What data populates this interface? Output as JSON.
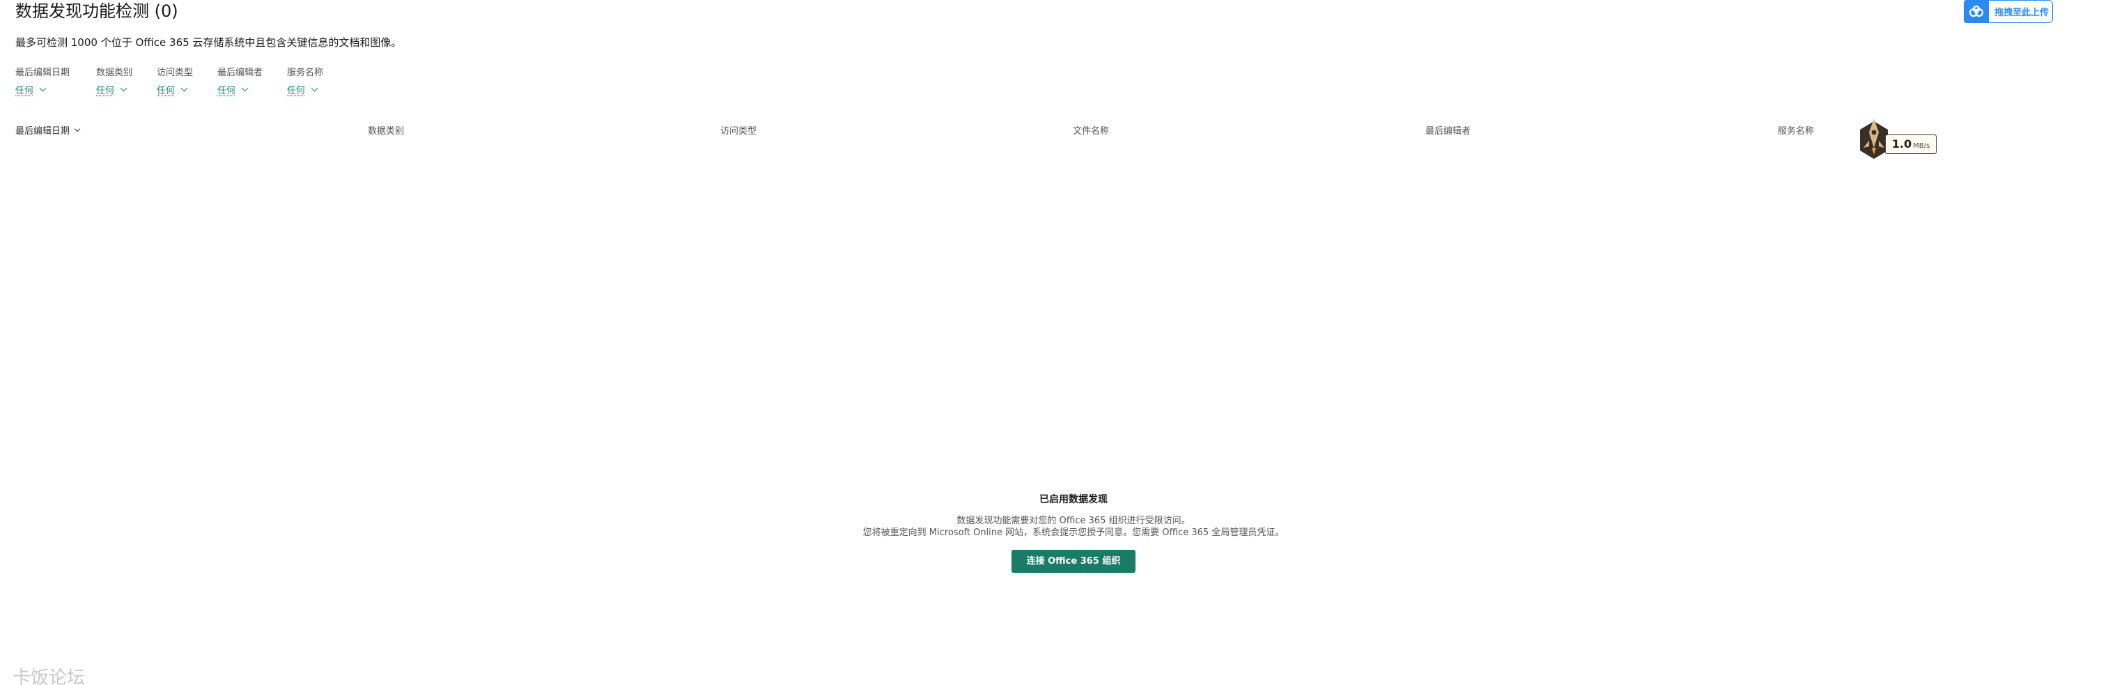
{
  "header": {
    "title": "数据发现功能检测 (0)",
    "subtitle": "最多可检测 1000 个位于 Office 365 云存储系统中且包含关键信息的文档和图像。"
  },
  "filters": [
    {
      "label": "最后编辑日期",
      "value": "任何"
    },
    {
      "label": "数据类别",
      "value": "任何"
    },
    {
      "label": "访问类型",
      "value": "任何"
    },
    {
      "label": "最后编辑者",
      "value": "任何"
    },
    {
      "label": "服务名称",
      "value": "任何"
    }
  ],
  "table": {
    "columns": [
      "最后编辑日期",
      "数据类别",
      "访问类型",
      "文件名称",
      "最后编辑者",
      "服务名称"
    ]
  },
  "empty_state": {
    "title": "已启用数据发现",
    "line1": "数据发现功能需要对您的 Office 365 组织进行受限访问。",
    "line2": "您将被重定向到 Microsoft Online 网站，系统会提示您授予同意。您需要 Office 365 全局管理员凭证。",
    "button": "连接 Office 365 组织"
  },
  "overlays": {
    "upload_label": "拖拽至此上传",
    "speed_value": "1.0",
    "speed_unit": "MB/s",
    "watermark": "卡饭论坛"
  },
  "colors": {
    "accent": "#1a7c67",
    "link": "#1f8a66",
    "upload_blue": "#2a8af0"
  }
}
